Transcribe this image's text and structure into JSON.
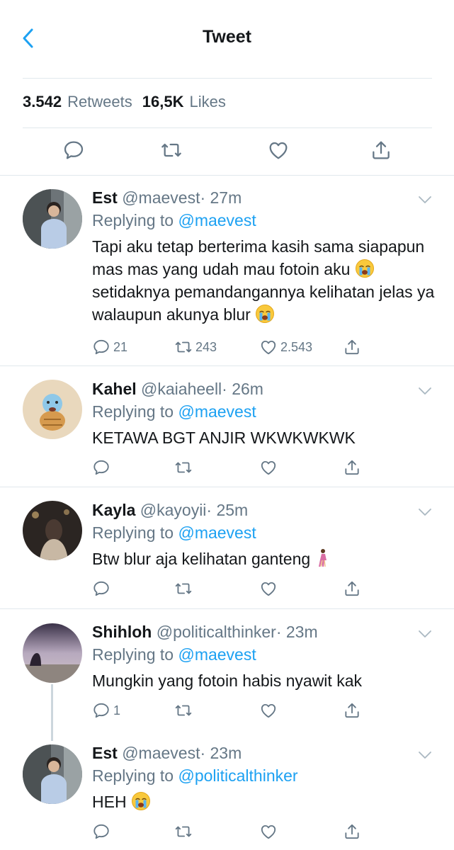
{
  "header": {
    "title": "Tweet",
    "back_icon": "chevron-left-icon"
  },
  "stats": {
    "retweets_count": "3.542",
    "retweets_label": "Retweets",
    "likes_count": "16,5K",
    "likes_label": "Likes"
  },
  "colors": {
    "accent": "#1da1f2",
    "text": "#14171a",
    "secondary": "#657786",
    "divider": "#e1e8ed"
  },
  "replies": [
    {
      "name": "Est",
      "handle": "@maevest",
      "time": "· 27m",
      "replying_label": "Replying to",
      "replying_to": "@maevest",
      "text_parts": [
        "Tapi aku tetap berterima kasih sama siapapun mas mas yang udah mau fotoin aku ",
        " setidaknya pemandangannya kelihatan jelas ya walaupun akunya blur "
      ],
      "reply_count": "21",
      "retweet_count": "243",
      "like_count": "2.543"
    },
    {
      "name": "Kahel",
      "handle": "@kaiaheell",
      "time": "· 26m",
      "replying_label": "Replying to",
      "replying_to": "@maevest",
      "text": "KETAWA BGT ANJIR WKWKWKWK"
    },
    {
      "name": "Kayla",
      "handle": "@kayoyii",
      "time": "· 25m",
      "replying_label": "Replying to",
      "replying_to": "@maevest",
      "text": "Btw blur aja kelihatan ganteng"
    },
    {
      "name": "Shihloh",
      "handle": "@politicalthinker",
      "time": "· 23m",
      "replying_label": "Replying to",
      "replying_to": "@maevest",
      "text": "Mungkin yang fotoin habis nyawit kak",
      "reply_count": "1"
    },
    {
      "name": "Est",
      "handle": "@maevest",
      "time": "· 23m",
      "replying_label": "Replying to",
      "replying_to": "@politicalthinker",
      "text": "HEH"
    }
  ]
}
